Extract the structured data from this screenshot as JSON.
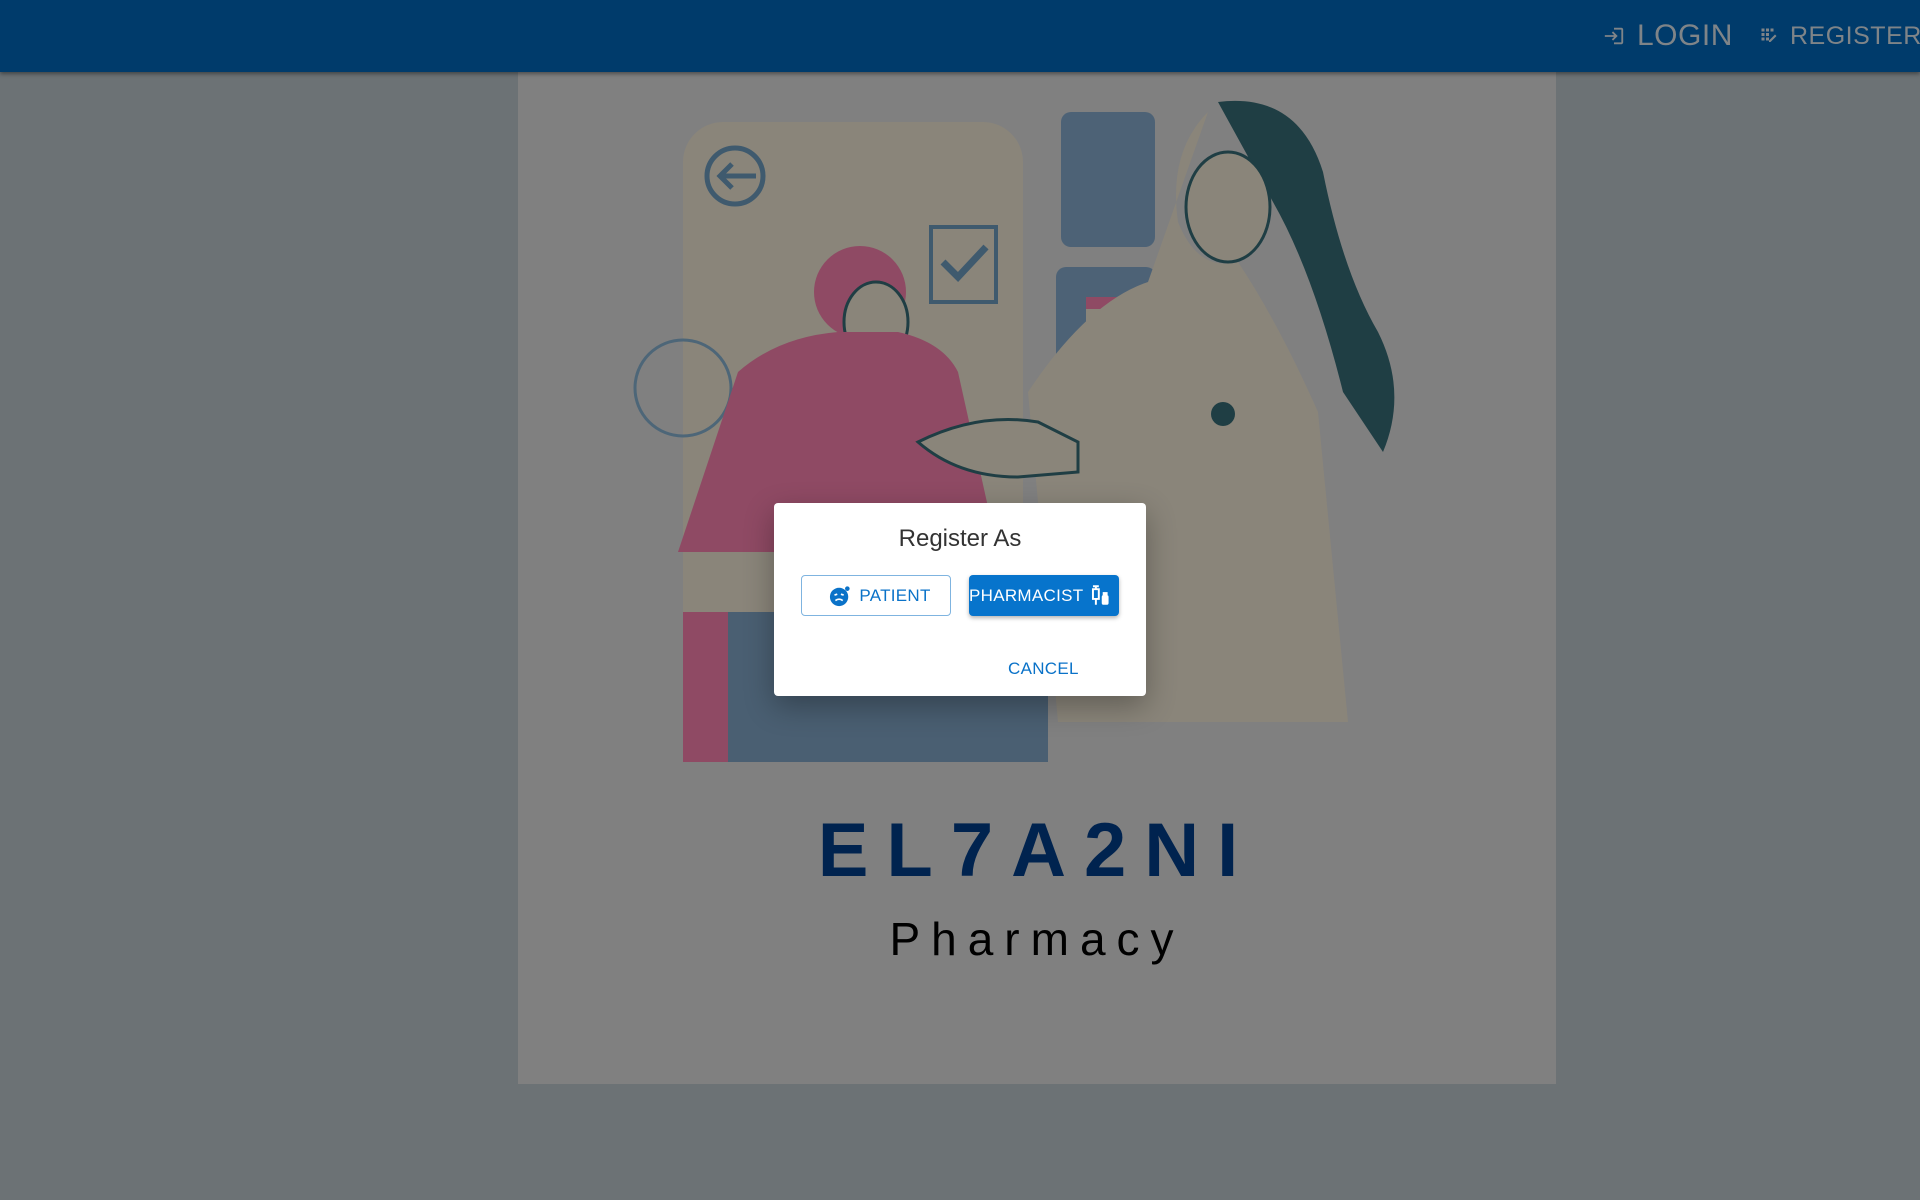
{
  "appbar": {
    "login_label": "LOGIN",
    "register_label": "REGISTER",
    "login_icon": "login-icon",
    "register_icon": "app-registration-icon"
  },
  "hero": {
    "brand_name": "EL7A2NI",
    "brand_subtitle": "Pharmacy"
  },
  "dialog": {
    "title": "Register As",
    "patient_label": "PATIENT",
    "pharmacist_label": "PHARMACIST",
    "cancel_label": "CANCEL",
    "patient_icon": "sick-face-icon",
    "pharmacist_icon": "vaccines-icon"
  },
  "colors": {
    "appbar": "#003b6b",
    "primary": "#0774cc"
  }
}
